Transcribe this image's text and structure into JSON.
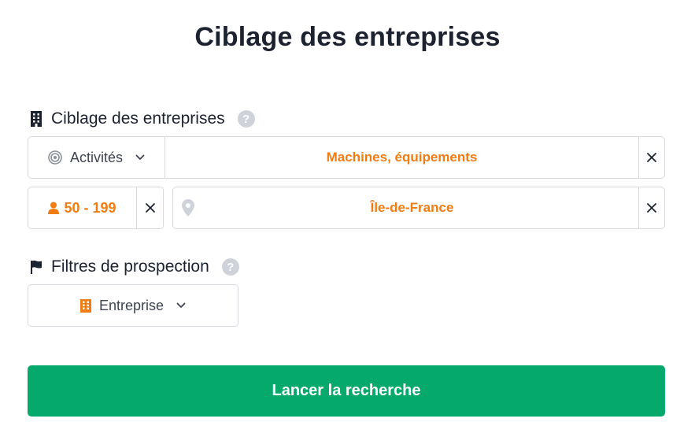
{
  "page": {
    "title": "Ciblage des entreprises"
  },
  "targeting": {
    "label": "Ciblage des entreprises",
    "help": "?",
    "activity_select": {
      "label": "Activités",
      "icon": "target-icon"
    },
    "activity_value": "Machines, équipements",
    "headcount_value": "50 - 199",
    "location_value": "Île-de-France"
  },
  "filters": {
    "label": "Filtres de prospection",
    "help": "?",
    "type_select": {
      "label": "Entreprise",
      "icon": "building-icon"
    }
  },
  "submit": {
    "label": "Lancer la recherche"
  },
  "colors": {
    "accent_orange": "#f07c14",
    "primary_green": "#04a96b",
    "text_dark": "#1c2230",
    "border": "#d6d9de",
    "help_gray": "#cfd3d9"
  }
}
